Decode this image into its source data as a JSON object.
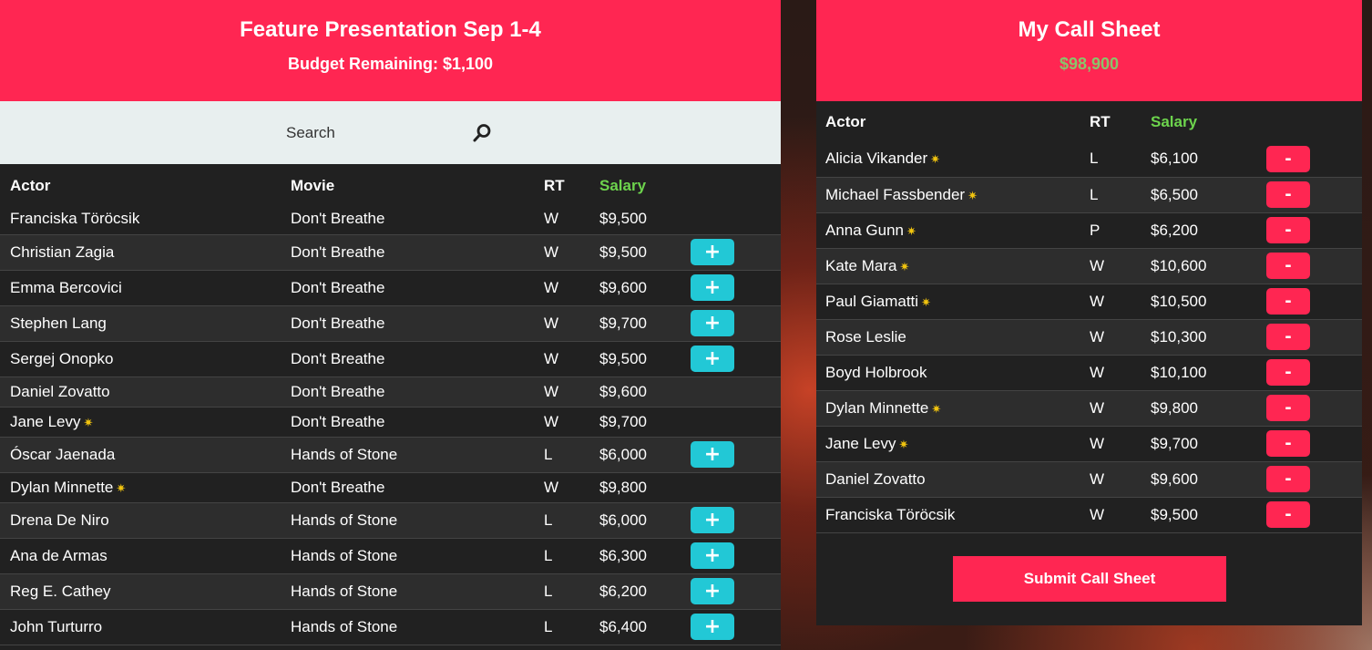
{
  "left": {
    "title": "Feature Presentation Sep 1-4",
    "budget": "Budget Remaining: $1,100",
    "search_placeholder": "Search",
    "headers": {
      "actor": "Actor",
      "movie": "Movie",
      "rt": "RT",
      "salary": "Salary"
    },
    "add_label": "+",
    "rows": [
      {
        "actor": "Franciska Töröcsik",
        "star": false,
        "movie": "Don't Breathe",
        "rt": "W",
        "salary": "$9,500",
        "addable": false
      },
      {
        "actor": "Christian Zagia",
        "star": false,
        "movie": "Don't Breathe",
        "rt": "W",
        "salary": "$9,500",
        "addable": true
      },
      {
        "actor": "Emma Bercovici",
        "star": false,
        "movie": "Don't Breathe",
        "rt": "W",
        "salary": "$9,600",
        "addable": true
      },
      {
        "actor": "Stephen Lang",
        "star": false,
        "movie": "Don't Breathe",
        "rt": "W",
        "salary": "$9,700",
        "addable": true
      },
      {
        "actor": "Sergej Onopko",
        "star": false,
        "movie": "Don't Breathe",
        "rt": "W",
        "salary": "$9,500",
        "addable": true
      },
      {
        "actor": "Daniel Zovatto",
        "star": false,
        "movie": "Don't Breathe",
        "rt": "W",
        "salary": "$9,600",
        "addable": false
      },
      {
        "actor": "Jane Levy",
        "star": true,
        "movie": "Don't Breathe",
        "rt": "W",
        "salary": "$9,700",
        "addable": false
      },
      {
        "actor": "Óscar Jaenada",
        "star": false,
        "movie": "Hands of Stone",
        "rt": "L",
        "salary": "$6,000",
        "addable": true
      },
      {
        "actor": "Dylan Minnette",
        "star": true,
        "movie": "Don't Breathe",
        "rt": "W",
        "salary": "$9,800",
        "addable": false
      },
      {
        "actor": "Drena De Niro",
        "star": false,
        "movie": "Hands of Stone",
        "rt": "L",
        "salary": "$6,000",
        "addable": true
      },
      {
        "actor": "Ana de Armas",
        "star": false,
        "movie": "Hands of Stone",
        "rt": "L",
        "salary": "$6,300",
        "addable": true
      },
      {
        "actor": "Reg E. Cathey",
        "star": false,
        "movie": "Hands of Stone",
        "rt": "L",
        "salary": "$6,200",
        "addable": true
      },
      {
        "actor": "John Turturro",
        "star": false,
        "movie": "Hands of Stone",
        "rt": "L",
        "salary": "$6,400",
        "addable": true
      }
    ]
  },
  "right": {
    "title": "My Call Sheet",
    "total": "$98,900",
    "headers": {
      "actor": "Actor",
      "rt": "RT",
      "salary": "Salary"
    },
    "remove_label": "-",
    "submit_label": "Submit Call Sheet",
    "rows": [
      {
        "actor": "Alicia Vikander",
        "star": true,
        "rt": "L",
        "salary": "$6,100"
      },
      {
        "actor": "Michael Fassbender",
        "star": true,
        "rt": "L",
        "salary": "$6,500"
      },
      {
        "actor": "Anna Gunn",
        "star": true,
        "rt": "P",
        "salary": "$6,200"
      },
      {
        "actor": "Kate Mara",
        "star": true,
        "rt": "W",
        "salary": "$10,600"
      },
      {
        "actor": "Paul Giamatti",
        "star": true,
        "rt": "W",
        "salary": "$10,500"
      },
      {
        "actor": "Rose Leslie",
        "star": false,
        "rt": "W",
        "salary": "$10,300"
      },
      {
        "actor": "Boyd Holbrook",
        "star": false,
        "rt": "W",
        "salary": "$10,100"
      },
      {
        "actor": "Dylan Minnette",
        "star": true,
        "rt": "W",
        "salary": "$9,800"
      },
      {
        "actor": "Jane Levy",
        "star": true,
        "rt": "W",
        "salary": "$9,700"
      },
      {
        "actor": "Daniel Zovatto",
        "star": false,
        "rt": "W",
        "salary": "$9,600"
      },
      {
        "actor": "Franciska Töröcsik",
        "star": false,
        "rt": "W",
        "salary": "$9,500"
      }
    ]
  },
  "colors": {
    "accent": "#ff2652",
    "add": "#22c8d6",
    "salary": "#6dd44d",
    "panel": "#212121"
  },
  "icons": {
    "search": "search-icon",
    "star": "star-icon"
  }
}
